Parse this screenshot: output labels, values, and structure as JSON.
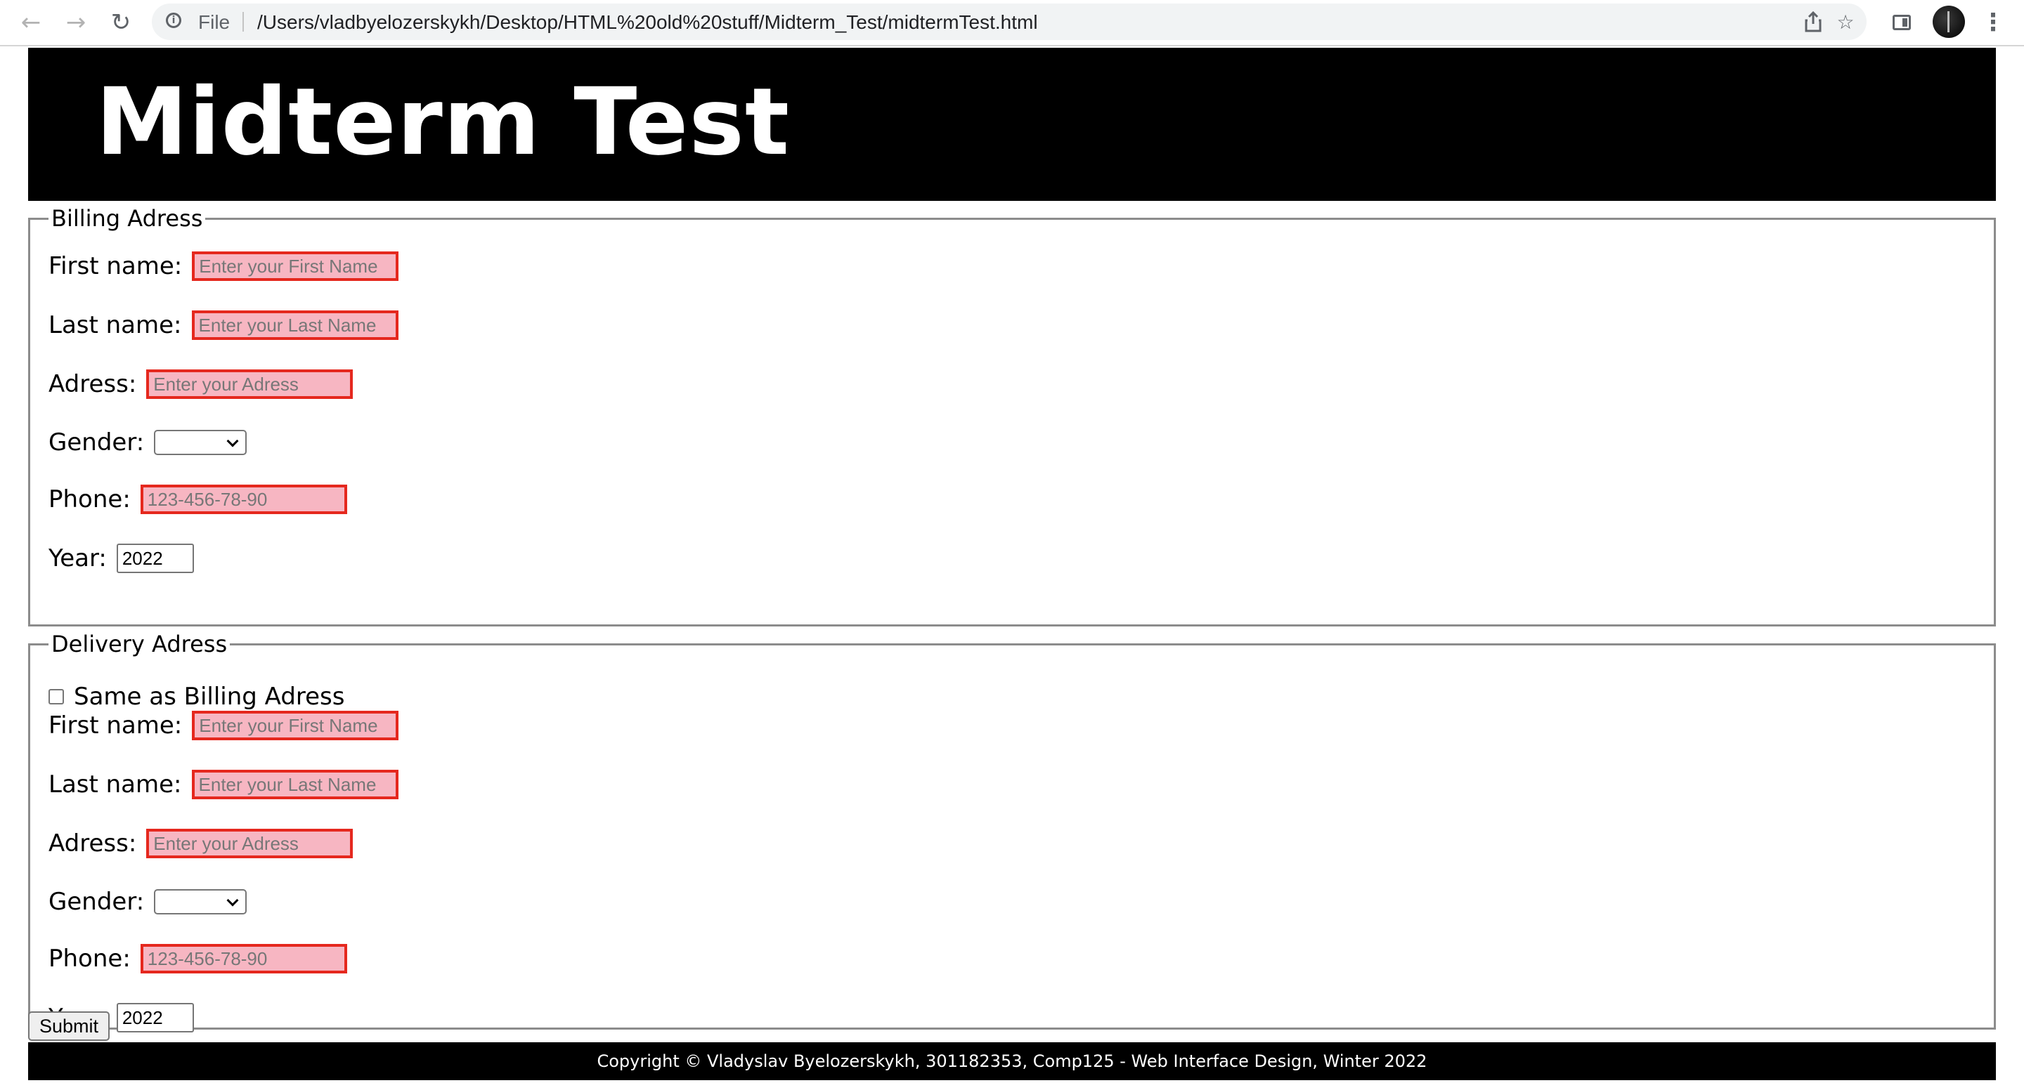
{
  "browser": {
    "back_icon": "arrow-left-icon",
    "forward_icon": "arrow-right-icon",
    "reload_icon": "reload-icon",
    "scheme_label": "File",
    "url": "/Users/vladbyelozerskykh/Desktop/HTML%20old%20stuff/Midterm_Test/midtermTest.html"
  },
  "header": {
    "title": "Midterm Test"
  },
  "billing": {
    "legend": "Billing Adress",
    "first_name_label": "First name:",
    "first_name_placeholder": "Enter your First Name",
    "last_name_label": "Last name:",
    "last_name_placeholder": "Enter your Last Name",
    "address_label": "Adress:",
    "address_placeholder": "Enter your Adress",
    "gender_label": "Gender:",
    "gender_value": "",
    "phone_label": "Phone:",
    "phone_placeholder": "123-456-78-90",
    "year_label": "Year:",
    "year_value": "2022"
  },
  "delivery": {
    "legend": "Delivery Adress",
    "same_as_label": "Same as Billing Adress",
    "same_as_checked": false,
    "first_name_label": "First name:",
    "first_name_placeholder": "Enter your First Name",
    "last_name_label": "Last name:",
    "last_name_placeholder": "Enter your Last Name",
    "address_label": "Adress:",
    "address_placeholder": "Enter your Adress",
    "gender_label": "Gender:",
    "gender_value": "",
    "phone_label": "Phone:",
    "phone_placeholder": "123-456-78-90",
    "year_label": "Year:",
    "year_value": "2022"
  },
  "form": {
    "submit_label": "Submit"
  },
  "footer": {
    "text": "Copyright © Vladyslav Byelozerskykh, 301182353, Comp125 - Web Interface Design, Winter 2022"
  },
  "colors": {
    "invalid_border": "#e5281e",
    "invalid_background": "#f7b6c2",
    "header_background": "#000000"
  }
}
